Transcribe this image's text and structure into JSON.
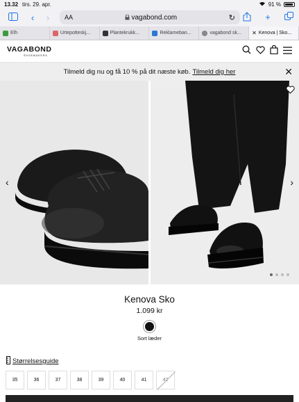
{
  "status_bar": {
    "time": "13.32",
    "date": "tirs. 29. apr.",
    "battery": "91 %"
  },
  "browser": {
    "url": "vagabond.com",
    "text_size_label": "AA",
    "tabs": [
      {
        "label": "Elh",
        "color": "#3a9d3a"
      },
      {
        "label": "Urtepotteskj...",
        "color": "#d66"
      },
      {
        "label": "Plantekrukk...",
        "color": "#333"
      },
      {
        "label": "Reklameban...",
        "color": "#2b77d4"
      },
      {
        "label": "vagabond sk...",
        "color": "#888"
      },
      {
        "label": "Kenova | Sko...",
        "color": "#555"
      }
    ]
  },
  "site": {
    "logo": "VAGABOND",
    "logo_sub": "SHOEMAKERS",
    "promo_text": "Tilmeld dig nu og få 10 % på dit næste køb.",
    "promo_link": "Tilmeld dig her"
  },
  "product": {
    "name": "Kenova Sko",
    "price": "1.099 kr",
    "color_name": "Sort læder",
    "color_hex": "#111111",
    "gallery_dots": 4,
    "active_dot": 0
  },
  "size_guide": {
    "label": "Størrelsesguide"
  },
  "sizes": [
    {
      "label": "35",
      "available": true
    },
    {
      "label": "36",
      "available": true
    },
    {
      "label": "37",
      "available": true
    },
    {
      "label": "38",
      "available": true
    },
    {
      "label": "39",
      "available": true
    },
    {
      "label": "40",
      "available": true
    },
    {
      "label": "41",
      "available": true
    },
    {
      "label": "42",
      "available": false
    }
  ]
}
